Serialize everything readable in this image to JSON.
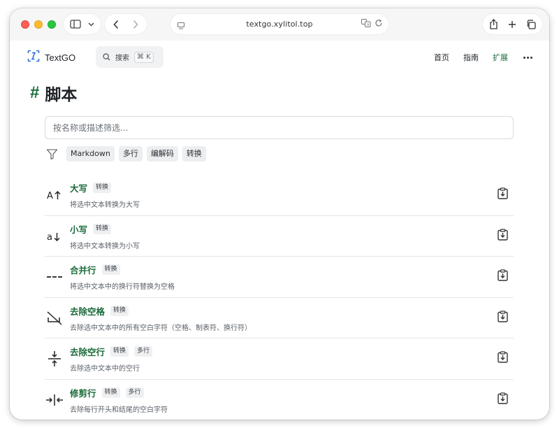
{
  "browser": {
    "url": "textgo.xylitol.top"
  },
  "site": {
    "logo_text": "TextGO",
    "search_label": "搜索",
    "search_shortcut": "⌘ K",
    "nav": [
      {
        "label": "首页"
      },
      {
        "label": "指南"
      },
      {
        "label": "扩展",
        "active": true
      }
    ],
    "accent_color": "#1b6b3a"
  },
  "page": {
    "hash": "#",
    "title": "脚本",
    "filter_placeholder": "按名称或描述筛选...",
    "filter_tags": [
      "Markdown",
      "多行",
      "编解码",
      "转换"
    ]
  },
  "scripts": [
    {
      "icon": "uppercase-icon",
      "name": "大写",
      "tags": [
        "转换"
      ],
      "desc": "将选中文本转换为大写"
    },
    {
      "icon": "lowercase-icon",
      "name": "小写",
      "tags": [
        "转换"
      ],
      "desc": "将选中文本转换为小写"
    },
    {
      "icon": "merge-lines-icon",
      "name": "合并行",
      "tags": [
        "转换"
      ],
      "desc": "将选中文本中的换行符替换为空格"
    },
    {
      "icon": "remove-spaces-icon",
      "name": "去除空格",
      "tags": [
        "转换"
      ],
      "desc": "去除选中文本中的所有空白字符（空格、制表符、换行符）"
    },
    {
      "icon": "remove-blank-lines-icon",
      "name": "去除空行",
      "tags": [
        "转换",
        "多行"
      ],
      "desc": "去除选中文本中的空行"
    },
    {
      "icon": "trim-lines-icon",
      "name": "修剪行",
      "tags": [
        "转换",
        "多行"
      ],
      "desc": "去除每行开头和结尾的空白字符"
    }
  ]
}
